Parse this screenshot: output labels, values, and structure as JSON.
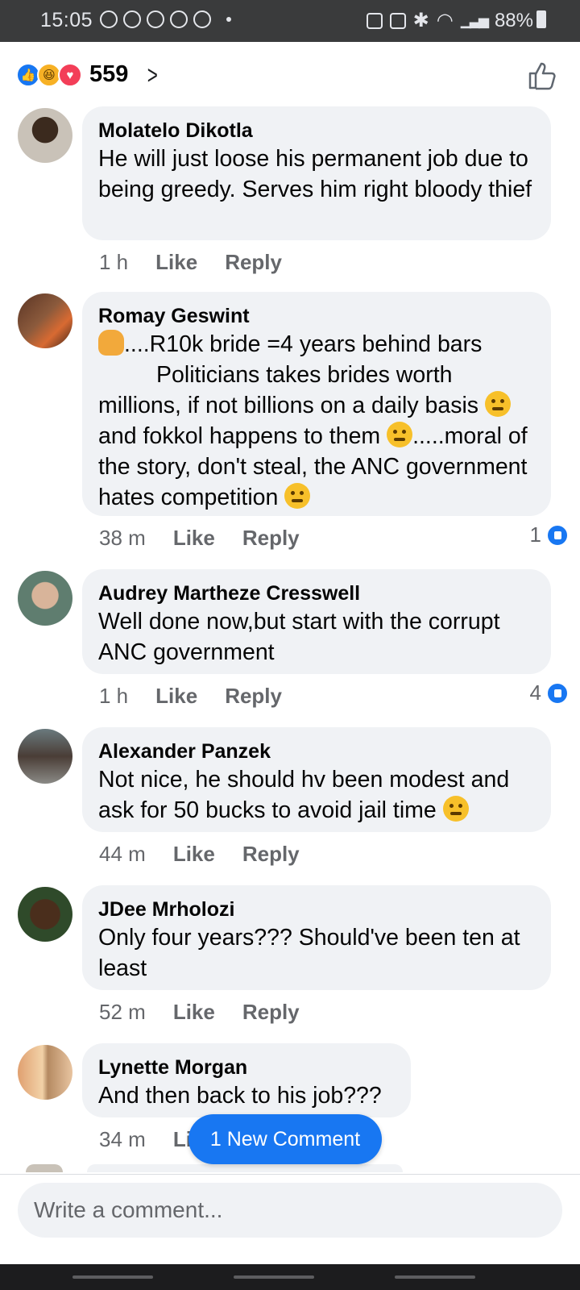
{
  "status_bar": {
    "time": "15:05",
    "battery": "88%",
    "icons": [
      "whatsapp-icon",
      "notification-icon",
      "notification-icon",
      "notification-icon",
      "notification-icon",
      "lock-icon",
      "alarm-icon",
      "bluetooth-icon",
      "wifi-icon",
      "signal-icon",
      "battery-icon"
    ]
  },
  "reactions": {
    "count": "559",
    "types": [
      "like",
      "haha",
      "love"
    ]
  },
  "comments": [
    {
      "name": "Molatelo Dikotla",
      "text": "He will just loose his permanent job due to being greedy. Serves him right bloody thief",
      "time": "1 h",
      "like_label": "Like",
      "reply_label": "Reply",
      "likes": ""
    },
    {
      "name": "Romay Geswint",
      "text_parts": [
        "....R10k bride =4 years behind bars",
        "Politicians takes brides worth millions, if not billions on a daily basis ",
        "and fokkol happens to them ",
        ".....moral of the story, don't steal, the ANC government hates competition "
      ],
      "time": "38 m",
      "like_label": "Like",
      "reply_label": "Reply",
      "likes": "1"
    },
    {
      "name": "Audrey Martheze Cresswell",
      "text": "Well done now,but start with the corrupt ANC government",
      "time": "1 h",
      "like_label": "Like",
      "reply_label": "Reply",
      "likes": "4"
    },
    {
      "name": "Alexander Panzek",
      "text": "Not nice, he should hv been modest and ask for 50 bucks to avoid jail time ",
      "time": "44 m",
      "like_label": "Like",
      "reply_label": "Reply",
      "likes": ""
    },
    {
      "name": "JDee Mrholozi",
      "text": "Only four years??? Should've been ten at least",
      "time": "52 m",
      "like_label": "Like",
      "reply_label": "Reply",
      "likes": ""
    },
    {
      "name": "Lynette Morgan",
      "text": "And then back to his job???",
      "time": "34 m",
      "like_label": "Li",
      "reply_label": "",
      "likes": ""
    }
  ],
  "new_comment_button": "1 New Comment",
  "composer": {
    "placeholder": "Write a comment..."
  },
  "colors": {
    "accent": "#1877f2",
    "bubble": "#f0f2f5",
    "secondary_text": "#65676b",
    "status_bar": "#3a3b3c"
  }
}
